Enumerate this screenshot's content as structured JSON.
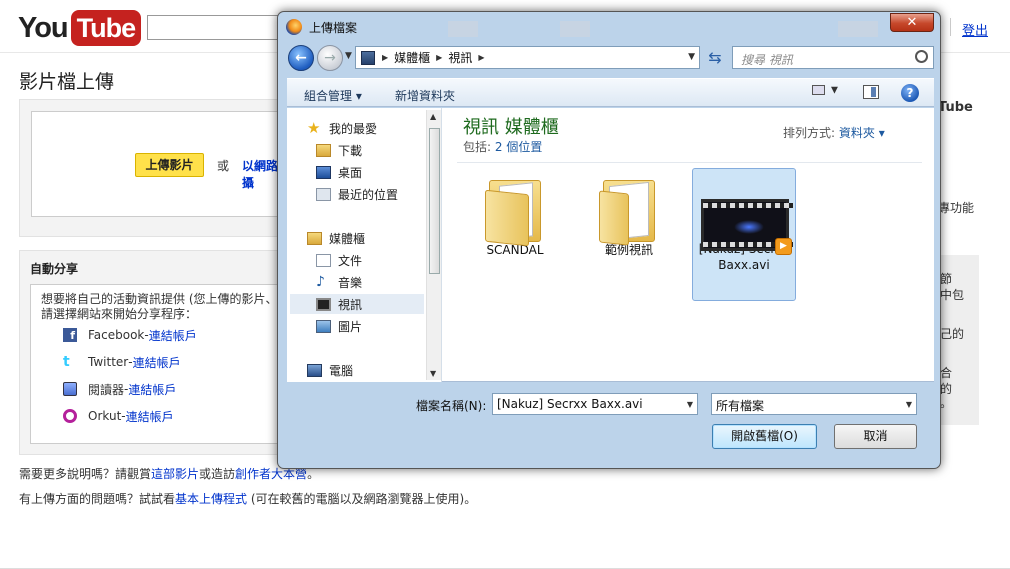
{
  "youtube": {
    "logo_you": "You",
    "logo_tube": "Tube",
    "signout": "登出",
    "page_title": "影片檔上傳",
    "upload_button": "上傳影片",
    "or_text": "或",
    "url_link": "以網路攝",
    "share": {
      "title": "自動分享",
      "desc_line1": "想要將自己的活動資訊提供 (您上傳的影片、",
      "desc_line2": "請選擇網站來開始分享程序：",
      "items": [
        {
          "name": "Facebook",
          "sep": " - ",
          "link": "連結帳戶",
          "color": "#3b5998"
        },
        {
          "name": "Twitter",
          "sep": " - ",
          "link": "連結帳戶",
          "color": "#33ccff"
        },
        {
          "name": "閱讀器",
          "sep": " - ",
          "link": "連結帳戶",
          "color": "#4a6fd0"
        },
        {
          "name": "Orkut",
          "sep": " - ",
          "link": "連結帳戶",
          "color": "#b4209b"
        }
      ]
    },
    "help1_a": "需要更多說明嗎？請觀賞",
    "help1_link1": "這部影片",
    "help1_b": "或造訪",
    "help1_link2": "創作者大本營",
    "help1_c": "。",
    "help2_a": "有上傳方面的問題嗎？試試看",
    "help2_link": "基本上傳程式",
    "help2_b": " (可在較舊的電腦以及網路瀏覽器上使用)。",
    "right_fragments": [
      "Tube",
      "專功能",
      "節",
      "中包",
      "己的",
      "合",
      "的",
      "。"
    ]
  },
  "dialog": {
    "title": "上傳檔案",
    "close_glyph": "✕",
    "address": {
      "crumb1": "媒體櫃",
      "crumb2": "視訊"
    },
    "search_placeholder": "搜尋 視訊",
    "toolbar": {
      "organize": "組合管理",
      "new_folder": "新增資料夾",
      "help": "?"
    },
    "nav": {
      "favorites": "我的最愛",
      "downloads": "下載",
      "desktop": "桌面",
      "recent": "最近的位置",
      "libraries": "媒體櫃",
      "documents": "文件",
      "music": "音樂",
      "videos": "視訊",
      "pictures": "圖片",
      "computer": "電腦"
    },
    "library_title": "視訊 媒體櫃",
    "library_sub_prefix": "包括:",
    "library_sub_count": "2 個位置",
    "arrange_label": "排列方式:",
    "arrange_value": "資料夾",
    "items": [
      {
        "label": "SCANDAL"
      },
      {
        "label": "範例視訊"
      },
      {
        "label": "[Nakuz] Secrxx Baxx.avi"
      }
    ],
    "filename_label": "檔案名稱(N):",
    "filename_value": "[Nakuz] Secrxx Baxx.avi",
    "filetype_value": "所有檔案",
    "open_button": "開啟舊檔(O)",
    "cancel_button": "取消"
  }
}
